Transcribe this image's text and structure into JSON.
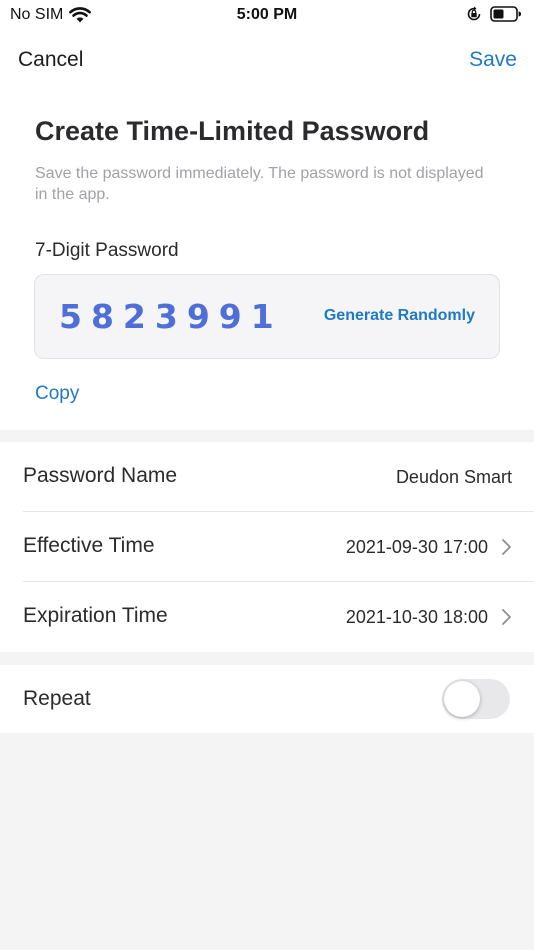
{
  "status_bar": {
    "carrier": "No SIM",
    "time": "5:00 PM",
    "icons": [
      "wifi-icon",
      "rotation-lock-icon",
      "battery-icon"
    ]
  },
  "nav": {
    "cancel_label": "Cancel",
    "save_label": "Save"
  },
  "header": {
    "title": "Create Time-Limited Password",
    "subtitle": "Save the password immediately. The password is not displayed in the app."
  },
  "password": {
    "label": "7-Digit Password",
    "digits": "5823991",
    "generate_label": "Generate Randomly",
    "copy_label": "Copy"
  },
  "settings": {
    "rows": [
      {
        "label": "Password Name",
        "value": "Deudon Smart"
      },
      {
        "label": "Effective Time",
        "value": "2021-09-30 17:00"
      },
      {
        "label": "Expiration Time",
        "value": "2021-10-30 18:00"
      }
    ]
  },
  "repeat": {
    "label": "Repeat",
    "enabled": false
  },
  "colors": {
    "accent": "#1f7ac4",
    "digits": "#4f6fd8",
    "background": "#f4f4f4",
    "card": "#ffffff"
  }
}
